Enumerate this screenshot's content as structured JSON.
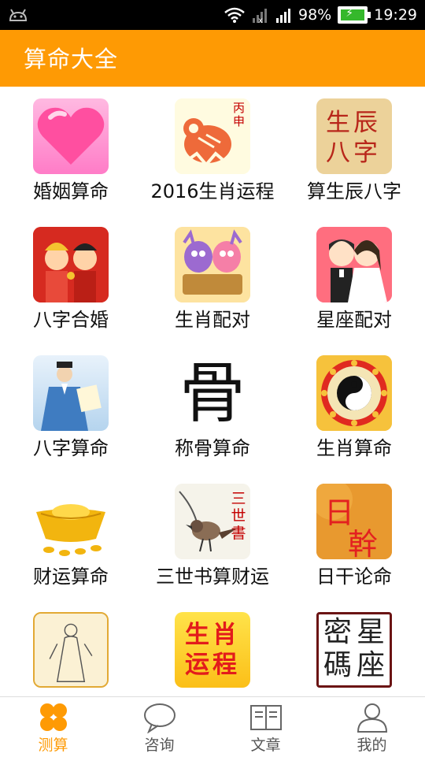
{
  "status": {
    "battery": "98%",
    "time": "19:29",
    "network": "2G"
  },
  "app": {
    "title": "算命大全"
  },
  "grid": {
    "items": [
      {
        "label": "婚姻算命",
        "icon": "heart-icon"
      },
      {
        "label": "2016生肖运程",
        "icon": "monkey-papercut-icon",
        "icon_text": "丙申"
      },
      {
        "label": "算生辰八字",
        "icon": "shengchen-bazi-icon",
        "icon_text": "生辰八字"
      },
      {
        "label": "八字合婚",
        "icon": "wedding-couple-icon"
      },
      {
        "label": "生肖配对",
        "icon": "zodiac-pair-icon"
      },
      {
        "label": "星座配对",
        "icon": "bride-groom-icon"
      },
      {
        "label": "八字算命",
        "icon": "scholar-icon"
      },
      {
        "label": "称骨算命",
        "icon": "bone-character-icon",
        "icon_text": "骨"
      },
      {
        "label": "生肖算命",
        "icon": "taiji-zodiac-wheel-icon"
      },
      {
        "label": "财运算命",
        "icon": "gold-ingot-icon"
      },
      {
        "label": "三世书算财运",
        "icon": "bird-painting-icon",
        "icon_text": "三世書"
      },
      {
        "label": "日干论命",
        "icon": "rigan-icon",
        "icon_text": "日幹"
      },
      {
        "label": "",
        "icon": "ancient-figure-icon"
      },
      {
        "label": "",
        "icon": "shengxiao-yuncheng-icon",
        "icon_text": "生肖运程"
      },
      {
        "label": "",
        "icon": "xingzuo-mima-icon",
        "icon_text": "星座密碼"
      }
    ]
  },
  "nav": {
    "items": [
      {
        "label": "测算",
        "icon": "clover-icon",
        "active": true
      },
      {
        "label": "咨询",
        "icon": "chat-bubble-icon"
      },
      {
        "label": "文章",
        "icon": "book-icon"
      },
      {
        "label": "我的",
        "icon": "user-icon"
      }
    ]
  },
  "colors": {
    "accent": "#fe9a04",
    "status_bar": "#000000"
  }
}
